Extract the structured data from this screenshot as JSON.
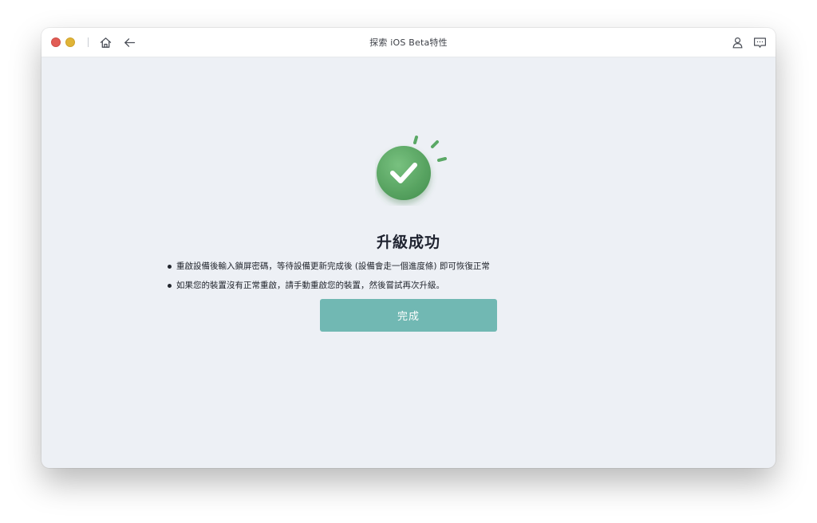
{
  "window": {
    "title": "探索 iOS Beta特性"
  },
  "toolbar": {
    "icons": [
      "home-icon",
      "back-arrow-icon",
      "user-icon",
      "feedback-icon"
    ]
  },
  "result": {
    "status_icon": "check-icon",
    "heading": "升級成功",
    "notes": [
      "重啟設備後輸入鎖屏密碼，等待設備更新完成後 (設備會走一個進度條) 即可恢復正常",
      "如果您的裝置沒有正常重啟，請手動重啟您的裝置，然後嘗試再次升級。"
    ],
    "done_label": "完成"
  },
  "colors": {
    "accent_button": "#71b8b3",
    "success_green": "#5aa865",
    "window_background": "#edf0f5"
  }
}
